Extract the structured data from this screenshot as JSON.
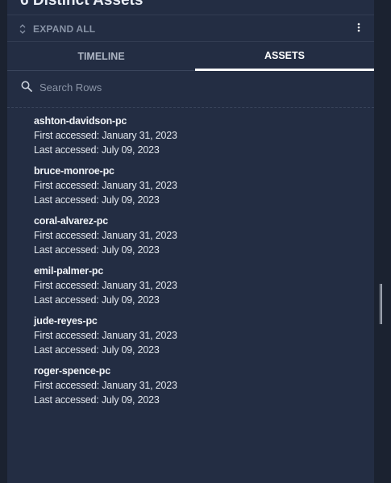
{
  "panel": {
    "title": "6 Distinct Assets"
  },
  "toolbar": {
    "expand_label": "EXPAND ALL",
    "expand_icon": "unfold-icon",
    "more_icon": "more-vertical-icon"
  },
  "tabs": [
    {
      "label": "TIMELINE",
      "active": false
    },
    {
      "label": "ASSETS",
      "active": true
    }
  ],
  "search": {
    "placeholder": "Search Rows",
    "value": "",
    "icon": "search-icon"
  },
  "assets": [
    {
      "name": "ashton-davidson-pc",
      "first": "First accessed: January 31, 2023",
      "last": "Last accessed: July 09, 2023"
    },
    {
      "name": "bruce-monroe-pc",
      "first": "First accessed: January 31, 2023",
      "last": "Last accessed: July 09, 2023"
    },
    {
      "name": "coral-alvarez-pc",
      "first": "First accessed: January 31, 2023",
      "last": "Last accessed: July 09, 2023"
    },
    {
      "name": "emil-palmer-pc",
      "first": "First accessed: January 31, 2023",
      "last": "Last accessed: July 09, 2023"
    },
    {
      "name": "jude-reyes-pc",
      "first": "First accessed: January 31, 2023",
      "last": "Last accessed: July 09, 2023"
    },
    {
      "name": "roger-spence-pc",
      "first": "First accessed: January 31, 2023",
      "last": "Last accessed: July 09, 2023"
    }
  ],
  "colors": {
    "background": "#1b2230",
    "panel": "#232d43",
    "active_tab": "#ffffff",
    "muted_text": "#8893a6"
  }
}
